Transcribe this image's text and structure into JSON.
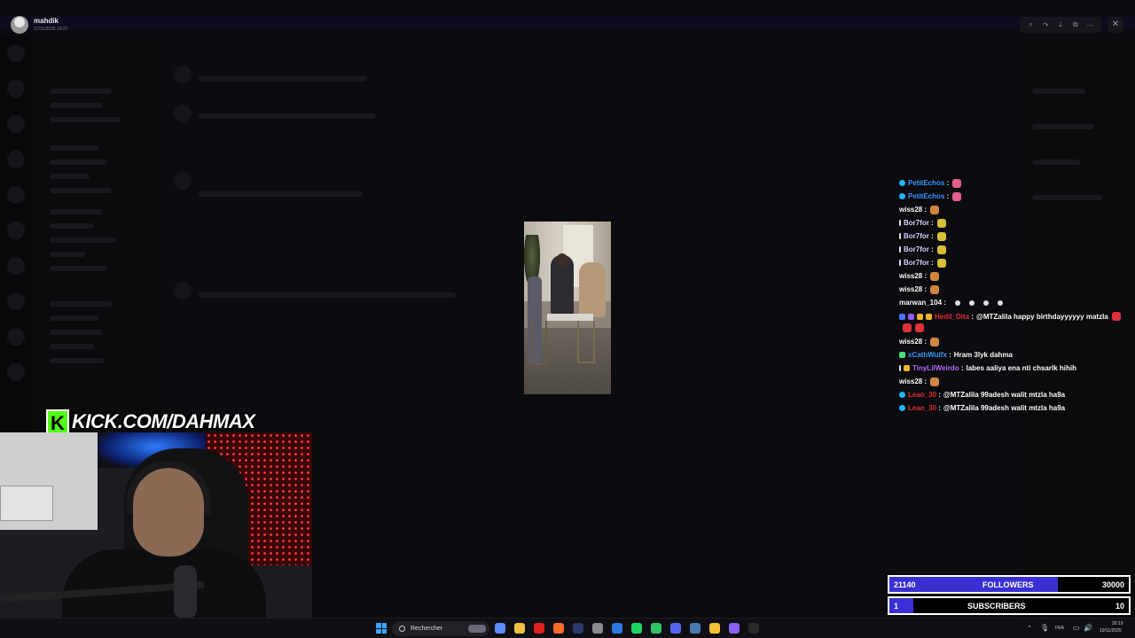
{
  "viewer": {
    "user_name": "mahdik",
    "timestamp": "17/11/2025 19:27",
    "tools": [
      "zoom-icon",
      "forward-icon",
      "download-icon",
      "open-external-icon",
      "more-icon"
    ],
    "close_icon": "close-icon"
  },
  "overlay": {
    "kick_logo": "K",
    "kick_url": "KICK.COM/DAHMAX"
  },
  "chat": {
    "messages": [
      {
        "user": "PetitEchos",
        "color": "#3b9bff",
        "badges": [
          "cyan"
        ],
        "text": "",
        "emotes": [
          "pink"
        ]
      },
      {
        "user": "PetitEchos",
        "color": "#3b9bff",
        "badges": [
          "cyan"
        ],
        "text": "",
        "emotes": [
          "pink"
        ]
      },
      {
        "user": "wiss28",
        "color": "#ffffff",
        "badges": [],
        "text": "",
        "emotes": [
          "cake"
        ]
      },
      {
        "user": "Bor7for",
        "color": "#d9cfff",
        "badges": [
          "white"
        ],
        "text": "",
        "emotes": [
          "duck"
        ]
      },
      {
        "user": "Bor7for",
        "color": "#d9cfff",
        "badges": [
          "white"
        ],
        "text": "",
        "emotes": [
          "duck"
        ]
      },
      {
        "user": "Bor7for",
        "color": "#d9cfff",
        "badges": [
          "white"
        ],
        "text": "",
        "emotes": [
          "duck"
        ]
      },
      {
        "user": "Bor7for",
        "color": "#d9cfff",
        "badges": [
          "white"
        ],
        "text": "",
        "emotes": [
          "duck"
        ]
      },
      {
        "user": "wiss28",
        "color": "#ffffff",
        "badges": [],
        "text": "",
        "emotes": [
          "cake"
        ]
      },
      {
        "user": "wiss28",
        "color": "#ffffff",
        "badges": [],
        "text": "",
        "emotes": [
          "cake"
        ]
      },
      {
        "user": "marwan_104",
        "color": "#ffffff",
        "badges": [],
        "text": "",
        "emotes": [
          "dot",
          "dot",
          "dot",
          "dot"
        ]
      },
      {
        "user": "Hedil_Dita",
        "color": "#e0323a",
        "badges": [
          "blue",
          "purple",
          "gold",
          "gold"
        ],
        "text": "@MTZalila happy birthdayyyyyy matzla",
        "emotes": [
          "red",
          "red",
          "red"
        ],
        "wrap": true
      },
      {
        "user": "wiss28",
        "color": "#ffffff",
        "badges": [],
        "text": "",
        "emotes": [
          "cake"
        ]
      },
      {
        "user": "xCathWulfx",
        "color": "#3b9bff",
        "badges": [
          "green"
        ],
        "text": "Hram 3lyk dahma",
        "emotes": []
      },
      {
        "user": "TinyLilWeirdo",
        "color": "#b56cff",
        "badges": [
          "white",
          "gold"
        ],
        "text": "labes aaliya ena nti chsarlk hihih",
        "emotes": []
      },
      {
        "user": "wiss28",
        "color": "#ffffff",
        "badges": [],
        "text": "",
        "emotes": [
          "cake"
        ]
      },
      {
        "user": "Leao_30",
        "color": "#e0323a",
        "badges": [
          "cyan"
        ],
        "text": "@MTZalila 99adesh walit mtzla ha9a",
        "emotes": []
      },
      {
        "user": "Leao_30",
        "color": "#e0323a",
        "badges": [
          "cyan"
        ],
        "text": "@MTZalila 99adesh walit mtzla ha9a",
        "emotes": []
      }
    ]
  },
  "goals": {
    "followers": {
      "current": "21140",
      "label": "FOLLOWERS",
      "target": "30000",
      "progress": 0.7047
    },
    "subscribers": {
      "current": "1",
      "label": "SUBSCRIBERS",
      "target": "10",
      "progress": 0.1
    }
  },
  "taskbar": {
    "search_placeholder": "Rechercher",
    "language": "FRA",
    "time": "20:19",
    "date": "19/11/2025",
    "apps": [
      {
        "name": "copilot-icon",
        "color": "#5a8cff"
      },
      {
        "name": "file-explorer-icon",
        "color": "#f0c040"
      },
      {
        "name": "red-app-icon",
        "color": "#e02020"
      },
      {
        "name": "orange-app-icon",
        "color": "#ff6a2a"
      },
      {
        "name": "dark-app-icon",
        "color": "#2a3a6a"
      },
      {
        "name": "settings-icon",
        "color": "#8a8a90"
      },
      {
        "name": "blue-app-icon",
        "color": "#2a7ae0"
      },
      {
        "name": "spotify-icon",
        "color": "#1ed760"
      },
      {
        "name": "green-app-icon",
        "color": "#33c46a"
      },
      {
        "name": "discord-icon",
        "color": "#5865f2"
      },
      {
        "name": "steam-icon",
        "color": "#4a7ab0"
      },
      {
        "name": "chrome-icon",
        "color": "#f1c232"
      },
      {
        "name": "purple-app-icon",
        "color": "#8a60ff"
      },
      {
        "name": "m-app-icon",
        "color": "#2a2a2a"
      }
    ]
  }
}
